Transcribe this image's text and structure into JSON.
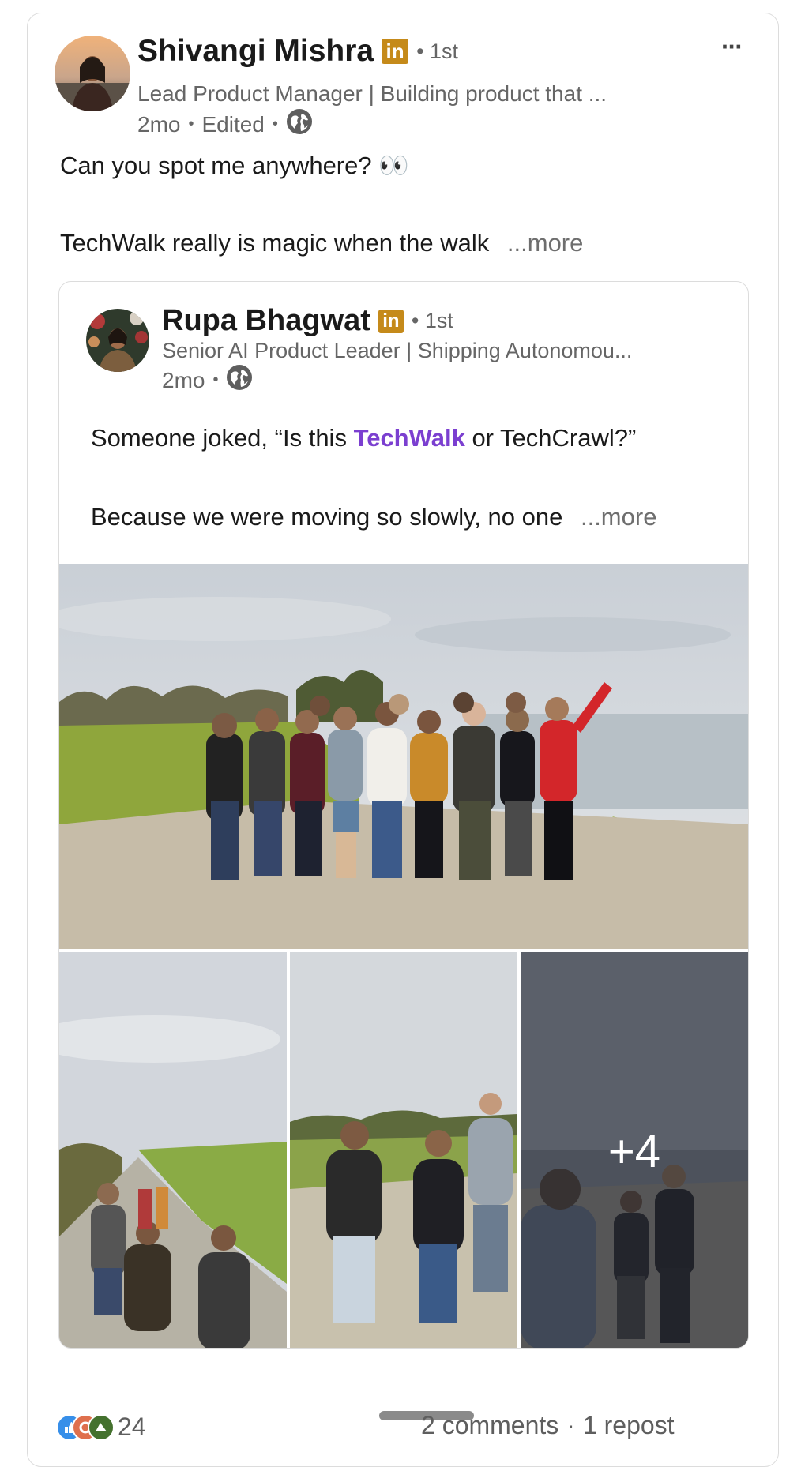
{
  "post": {
    "author": {
      "name": "Shivangi Mishra",
      "badge": "in",
      "degree": "• 1st",
      "headline": "Lead Product Manager | Building product that ...",
      "time": "2mo",
      "edited": "Edited",
      "sep": "•",
      "visibility_icon": "globe-icon"
    },
    "menu_label": "···",
    "text_line1": "Can you spot me anywhere? 👀",
    "text_line2": "TechWalk really is magic when the walk",
    "more_label": "...more"
  },
  "reshared": {
    "author": {
      "name": "Rupa Bhagwat",
      "badge": "in",
      "degree": "• 1st",
      "headline": "Senior AI Product Leader | Shipping Autonomou...",
      "time": "2mo",
      "sep": "•",
      "visibility_icon": "globe-icon"
    },
    "text_prefix": "Someone joked, “Is this ",
    "hashtag": "TechWalk",
    "text_suffix": " or TechCrawl?”",
    "text_line2": "Because we were moving so slowly, no one",
    "more_label": "...more",
    "photos": {
      "extra_count": "+4"
    }
  },
  "social": {
    "reaction_icons": [
      "like-icon",
      "celebrate-icon",
      "support-icon"
    ],
    "reaction_count": "24",
    "comments": "2 comments",
    "dot": "·",
    "reposts": "1 repost"
  },
  "colors": {
    "accent_hashtag": "#7b3fd0",
    "linkedin_badge": "#c58a1a",
    "like_blue": "#378fe9",
    "celebrate_green": "#44712e",
    "love_red": "#df704d"
  }
}
